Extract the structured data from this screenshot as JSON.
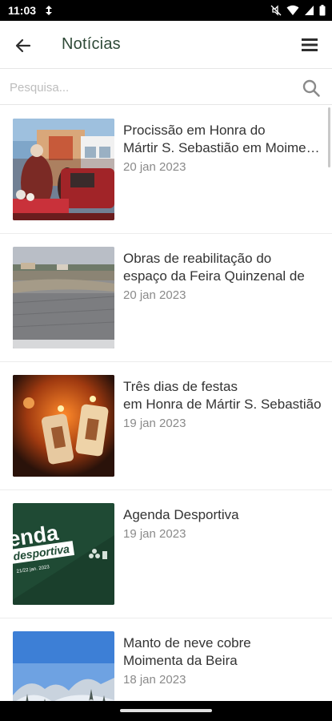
{
  "status_bar": {
    "time": "11:03",
    "icons": [
      "data-saver-icon",
      "mute-icon",
      "wifi-icon",
      "signal-icon",
      "battery-icon"
    ]
  },
  "app_bar": {
    "title": "Notícias",
    "back_icon": "arrow-back-icon",
    "menu_icon": "hamburger-menu-icon",
    "title_color": "#2f4a38"
  },
  "search": {
    "placeholder": "Pesquisa...",
    "value": "",
    "icon": "search-icon"
  },
  "news": [
    {
      "title_line1": "Procissão em Honra do",
      "title_line2": "Mártir S. Sebastião em Moimenta",
      "date": "20 jan 2023",
      "image": "procession-photo"
    },
    {
      "title_line1": "Obras de reabilitação do",
      "title_line2": "espaço da Feira Quinzenal de",
      "date": "20 jan 2023",
      "image": "fairground-photo"
    },
    {
      "title_line1": "Três dias de festas",
      "title_line2": "em Honra de Mártir S. Sebastião",
      "date": "19 jan 2023",
      "image": "candles-photo"
    },
    {
      "title_line1": "Agenda Desportiva",
      "title_line2": "",
      "date": "19 jan 2023",
      "image": "agenda-poster",
      "poster_text": [
        "enda",
        "desportiva",
        "21/22 jan. 2023"
      ]
    },
    {
      "title_line1": "Manto de neve cobre",
      "title_line2": "Moimenta da Beira",
      "date": "18 jan 2023",
      "image": "snow-photo"
    }
  ]
}
